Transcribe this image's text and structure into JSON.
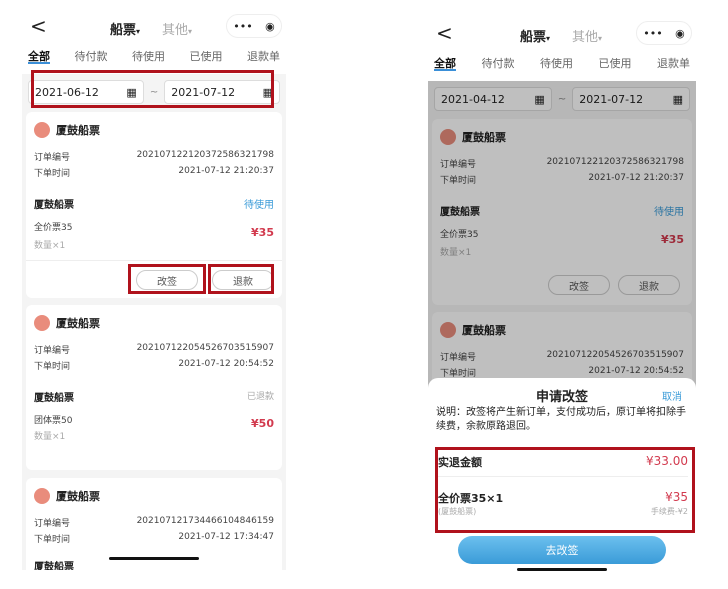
{
  "header": {
    "title": "船票",
    "title_caret": "▾",
    "other": "其他",
    "other_caret": "▾",
    "more": "•••",
    "target": "◉",
    "back": "<"
  },
  "tabs": [
    "全部",
    "待付款",
    "待使用",
    "已使用",
    "退款单"
  ],
  "left": {
    "date_from": "2021-06-12",
    "date_to": "2021-07-12",
    "tilde": "~",
    "orders": [
      {
        "name": "厦鼓船票",
        "order_no_label": "订单编号",
        "order_no": "20210712212037258632179​8",
        "time_label": "下单时间",
        "time": "2021-07-12 21:20:37",
        "product": "厦鼓船票",
        "status": "待使用",
        "ticket": "全价票35",
        "qty": "数量×1",
        "price": "¥35",
        "actions": [
          "改签",
          "退款"
        ]
      },
      {
        "name": "厦鼓船票",
        "order_no_label": "订单编号",
        "order_no": "202107122054526703515907",
        "time_label": "下单时间",
        "time": "2021-07-12 20:54:52",
        "product": "厦鼓船票",
        "status": "已退款",
        "ticket": "团体票50",
        "qty": "数量×1",
        "price": "¥50"
      },
      {
        "name": "厦鼓船票",
        "order_no_label": "订单编号",
        "order_no": "202107121734466104846159",
        "time_label": "下单时间",
        "time": "2021-07-12 17:34:47",
        "product": "厦鼓船票"
      }
    ]
  },
  "right": {
    "date_from": "2021-04-12",
    "date_to": "2021-07-12",
    "tilde": "~",
    "orders": [
      {
        "name": "厦鼓船票",
        "order_no_label": "订单编号",
        "order_no": "202107122120372586321798",
        "time_label": "下单时间",
        "time": "2021-07-12 21:20:37",
        "product": "厦鼓船票",
        "status": "待使用",
        "ticket": "全价票35",
        "qty": "数量×1",
        "price": "¥35",
        "actions": [
          "改签",
          "退款"
        ]
      },
      {
        "name": "厦鼓船票",
        "order_no_label": "订单编号",
        "order_no": "202107122054526703515907",
        "time_label": "下单时间",
        "time": "2021-07-12 20:54:52"
      }
    ],
    "sheet": {
      "title": "申请改签",
      "cancel": "取消",
      "note": "说明：改签将产生新订单，支付成功后，原订单将扣除手续费，余款原路退回。",
      "refund_label": "实退金额",
      "refund": "¥33.00",
      "item": "全价票35×1",
      "item_sub": "(厦鼓船票)",
      "item_price": "¥35",
      "fee": "手续费-¥2",
      "submit": "去改签"
    }
  },
  "colors": {
    "accent": "#3a9bd8",
    "price": "#d23a4e",
    "highlight": "#b0121c"
  }
}
